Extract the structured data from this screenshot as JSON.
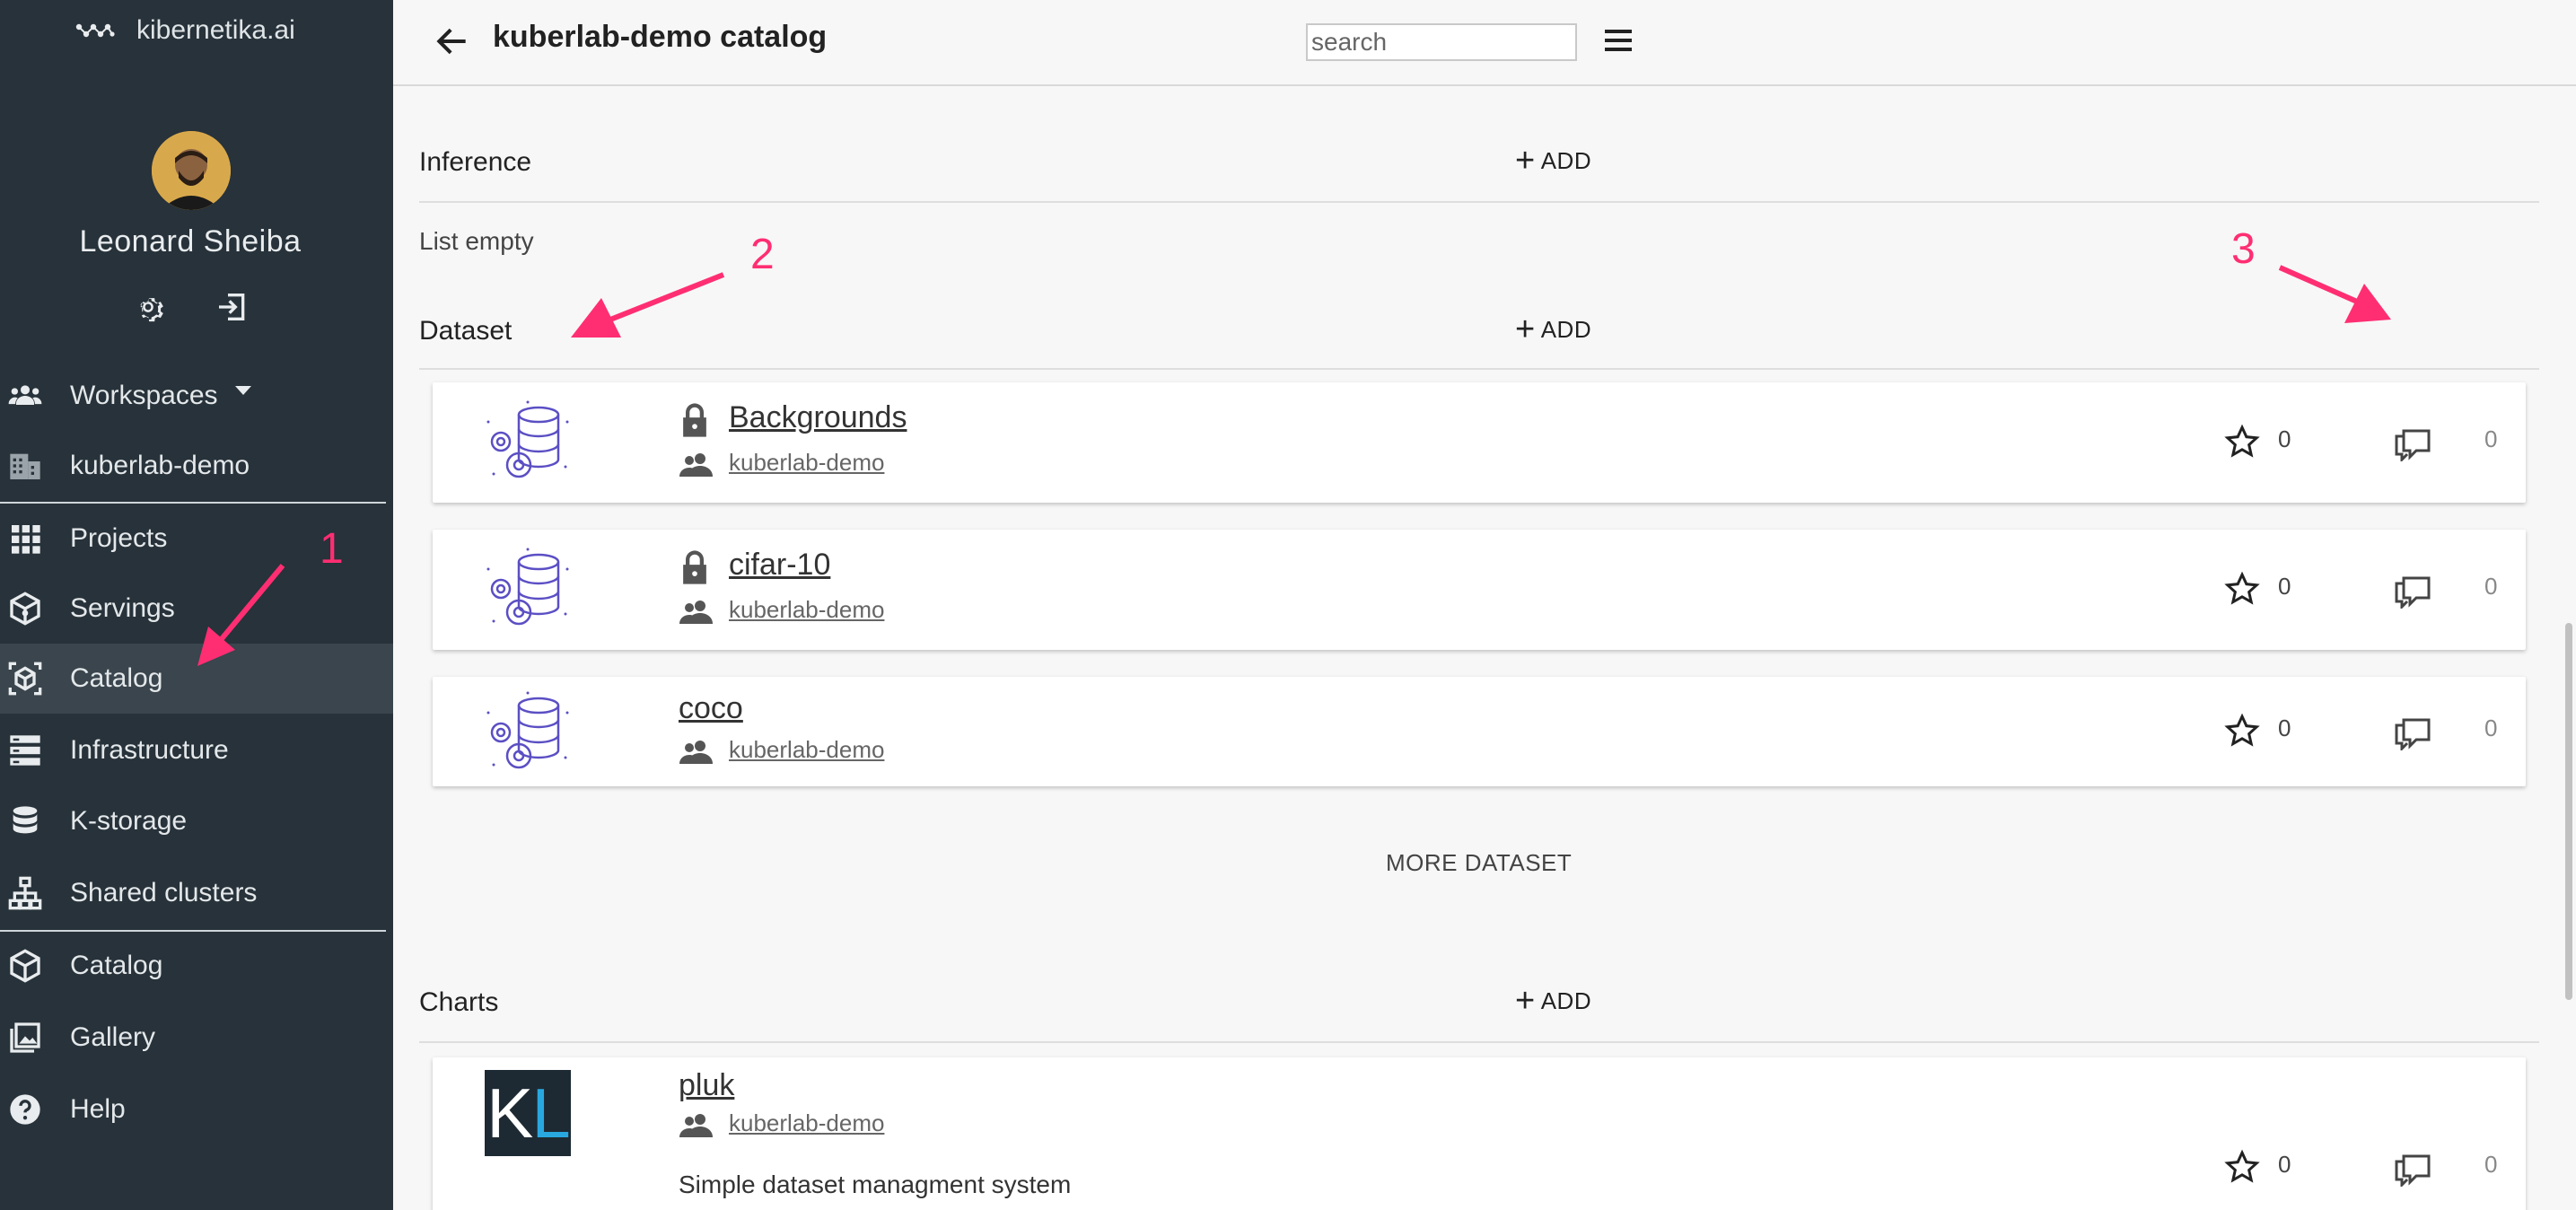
{
  "sidebar": {
    "brand": "kibernetika.ai",
    "user": {
      "name": "Leonard Sheiba"
    },
    "items": [
      {
        "label": "Workspaces",
        "icon": "users-icon"
      },
      {
        "label": "kuberlab-demo",
        "icon": "building-icon"
      },
      {
        "label": "Projects",
        "icon": "grid-icon"
      },
      {
        "label": "Servings",
        "icon": "cube-gear-icon"
      },
      {
        "label": "Catalog",
        "icon": "cube-catalog-icon",
        "active": true
      },
      {
        "label": "Infrastructure",
        "icon": "server-icon"
      },
      {
        "label": "K-storage",
        "icon": "database-icon"
      },
      {
        "label": "Shared clusters",
        "icon": "sitemap-icon"
      },
      {
        "label": "Catalog",
        "icon": "cube-icon"
      },
      {
        "label": "Gallery",
        "icon": "gallery-icon"
      },
      {
        "label": "Help",
        "icon": "help-icon"
      }
    ]
  },
  "header": {
    "title": "kuberlab-demo catalog",
    "search_placeholder": "search"
  },
  "sections": {
    "inference": {
      "title": "Inference",
      "add_label": "ADD",
      "empty_text": "List empty"
    },
    "dataset": {
      "title": "Dataset",
      "add_label": "ADD",
      "more_label": "MORE DATASET",
      "items": [
        {
          "name": "Backgrounds",
          "owner": "kuberlab-demo",
          "locked": true,
          "stars": "0",
          "comments": "0"
        },
        {
          "name": "cifar-10",
          "owner": "kuberlab-demo",
          "locked": true,
          "stars": "0",
          "comments": "0"
        },
        {
          "name": "coco",
          "owner": "kuberlab-demo",
          "locked": false,
          "stars": "0",
          "comments": "0"
        }
      ]
    },
    "charts": {
      "title": "Charts",
      "add_label": "ADD",
      "items": [
        {
          "name": "pluk",
          "owner": "kuberlab-demo",
          "description": "Simple dataset managment system",
          "logo_k": "K",
          "logo_l": "L",
          "stars": "0",
          "comments": "0"
        }
      ]
    }
  },
  "annotations": {
    "one": "1",
    "two": "2",
    "three": "3"
  },
  "colors": {
    "sidebar": "#27323a",
    "annotation": "#ff2e72",
    "accent": "#29a8e0"
  }
}
